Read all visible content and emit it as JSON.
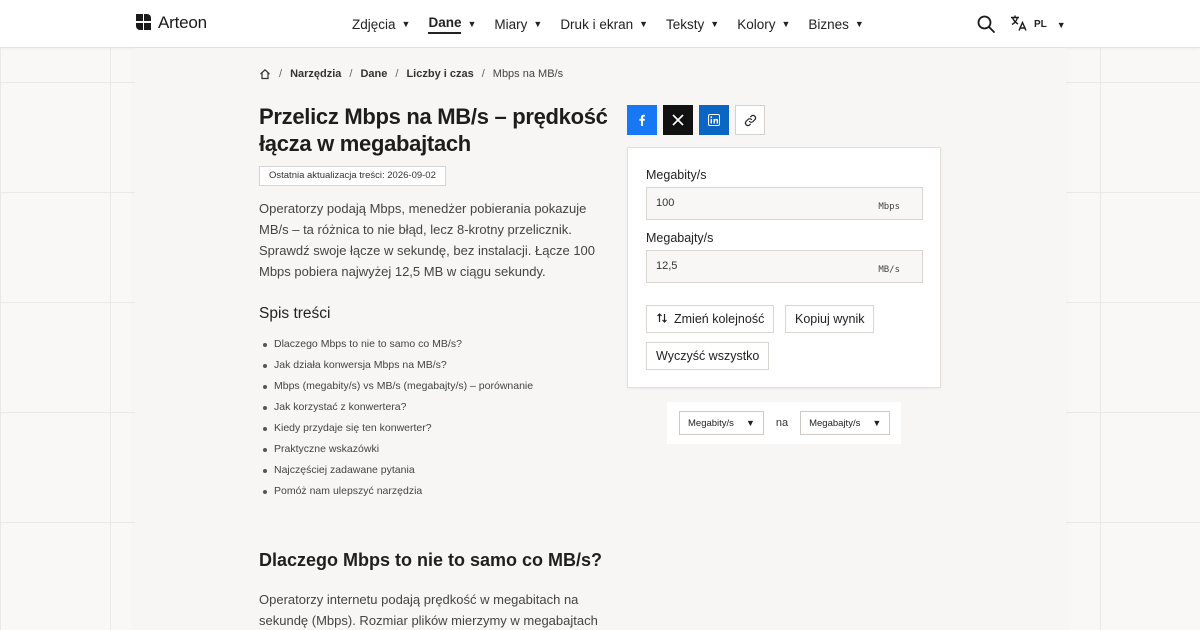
{
  "header": {
    "brand": "Arteon",
    "nav": [
      {
        "label": "Zdjęcia",
        "active": false
      },
      {
        "label": "Dane",
        "active": true
      },
      {
        "label": "Miary",
        "active": false
      },
      {
        "label": "Druk i ekran",
        "active": false
      },
      {
        "label": "Teksty",
        "active": false
      },
      {
        "label": "Kolory",
        "active": false
      },
      {
        "label": "Biznes",
        "active": false
      }
    ],
    "lang": "PL"
  },
  "breadcrumb": {
    "items": [
      "Narzędzia",
      "Dane",
      "Liczby i czas"
    ],
    "current": "Mbps na MB/s"
  },
  "article": {
    "title": "Przelicz Mbps na MB/s – prędkość łącza w megabajtach",
    "updated": "Ostatnia aktualizacja treści: 2026-09-02",
    "intro": "Operatorzy podają Mbps, menedżer pobierania pokazuje MB/s – ta różnica to nie błąd, lecz 8-krotny przelicznik. Sprawdź swoje łącze w sekundę, bez instalacji. Łącze 100 Mbps pobiera najwyżej 12,5 MB w ciągu sekundy.",
    "toc_title": "Spis treści",
    "toc": [
      "Dlaczego Mbps to nie to samo co MB/s?",
      "Jak działa konwersja Mbps na MB/s?",
      "Mbps (megabity/s) vs MB/s (megabajty/s) – porównanie",
      "Jak korzystać z konwertera?",
      "Kiedy przydaje się ten konwerter?",
      "Praktyczne wskazówki",
      "Najczęściej zadawane pytania",
      "Pomóż nam ulepszyć narzędzia"
    ],
    "section_title": "Dlaczego Mbps to nie to samo co MB/s?",
    "section_body": "Operatorzy internetu podają prędkość w megabitach na sekundę (Mbps). Rozmiar plików mierzymy w megabajtach"
  },
  "converter": {
    "input_label": "Megabity/s",
    "input_value": "100",
    "input_unit": "Mbps",
    "output_label": "Megabajty/s",
    "output_value": "12,5",
    "output_unit": "MB/s",
    "swap_label": "Zmień kolejność",
    "copy_label": "Kopiuj wynik",
    "clear_label": "Wyczyść wszystko"
  },
  "selectors": {
    "from": "Megabity/s",
    "connector": "na",
    "to": "Megabajty/s"
  },
  "colors": {
    "facebook": "#1877f2",
    "x": "#111111",
    "linkedin": "#0a66c2"
  }
}
